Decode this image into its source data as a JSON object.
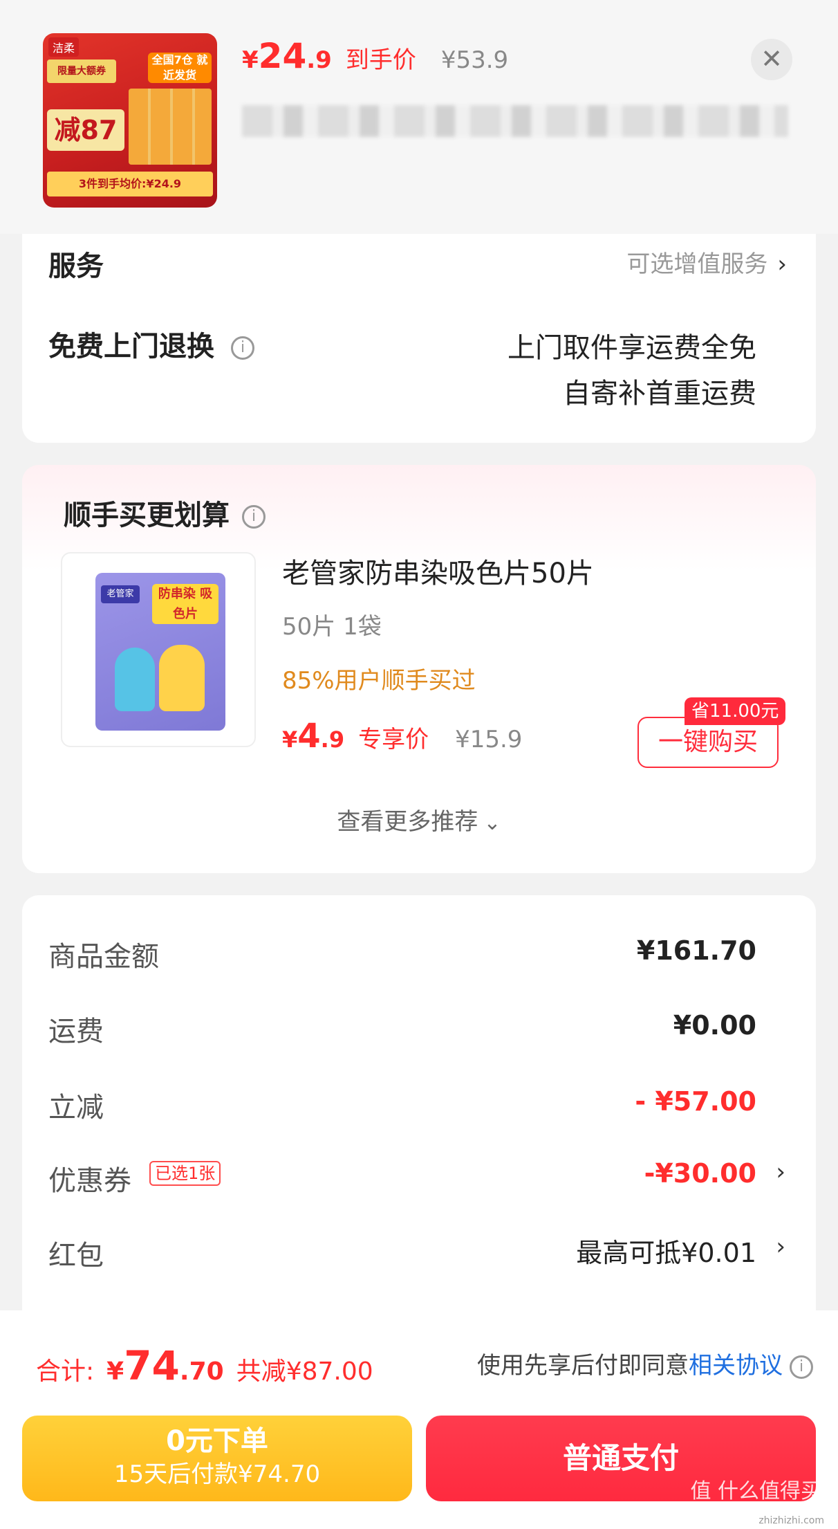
{
  "header": {
    "thumb": {
      "brand": "洁柔",
      "promo_top": "限量大额券",
      "badge": "全国7仓 就近发货",
      "promo_big": "减87",
      "strip": "3件到手均价:¥24.9"
    },
    "price": {
      "yen": "¥",
      "int": "24",
      "dec": ".9",
      "tag": "到手价",
      "original": "¥53.9"
    },
    "close_icon": "✕"
  },
  "service": {
    "title": "服务",
    "right_link": "可选增值服务",
    "row_label": "免费上门退换",
    "line1": "上门取件享运费全免",
    "line2": "自寄补首重运费"
  },
  "addon": {
    "title": "顺手买更划算",
    "product": {
      "name": "老管家防串染吸色片50片",
      "spec": "50片 1袋",
      "stat": "85%用户顺手买过",
      "price_yen": "¥",
      "price_int": "4",
      "price_dec": ".9",
      "price_tag": "专享价",
      "original": "¥15.9",
      "pack_label": "老管家",
      "pack_big": "防串染 吸色片"
    },
    "save_badge": "省11.00元",
    "buy_label": "一键购买",
    "more": "查看更多推荐"
  },
  "summary": {
    "rows": [
      {
        "label": "商品金额",
        "value": "¥161.70"
      },
      {
        "label": "运费",
        "value": "¥0.00"
      },
      {
        "label": "立减",
        "value": "- ¥57.00"
      },
      {
        "label": "优惠券",
        "value": "-¥30.00",
        "tag": "已选1张"
      },
      {
        "label": "红包",
        "value": "最高可抵¥0.01"
      }
    ]
  },
  "bottom": {
    "total_label": "合计:",
    "total_yen": "¥",
    "total_int": "74",
    "total_dec": ".70",
    "total_saved": "共减¥87.00",
    "agree_text": "使用先享后付即同意",
    "agree_link": "相关协议",
    "later_line1": "0元下单",
    "later_line2": "15天后付款¥74.70",
    "pay_label": "普通支付"
  },
  "watermark": {
    "text": "值 什么值得买",
    "url": "zhizhizhi.com"
  },
  "colors": {
    "accent_red": "#ff2d2d",
    "orange": "#e08a1e",
    "link_blue": "#1f6fe0",
    "later_yellow": "#ffc22a"
  }
}
